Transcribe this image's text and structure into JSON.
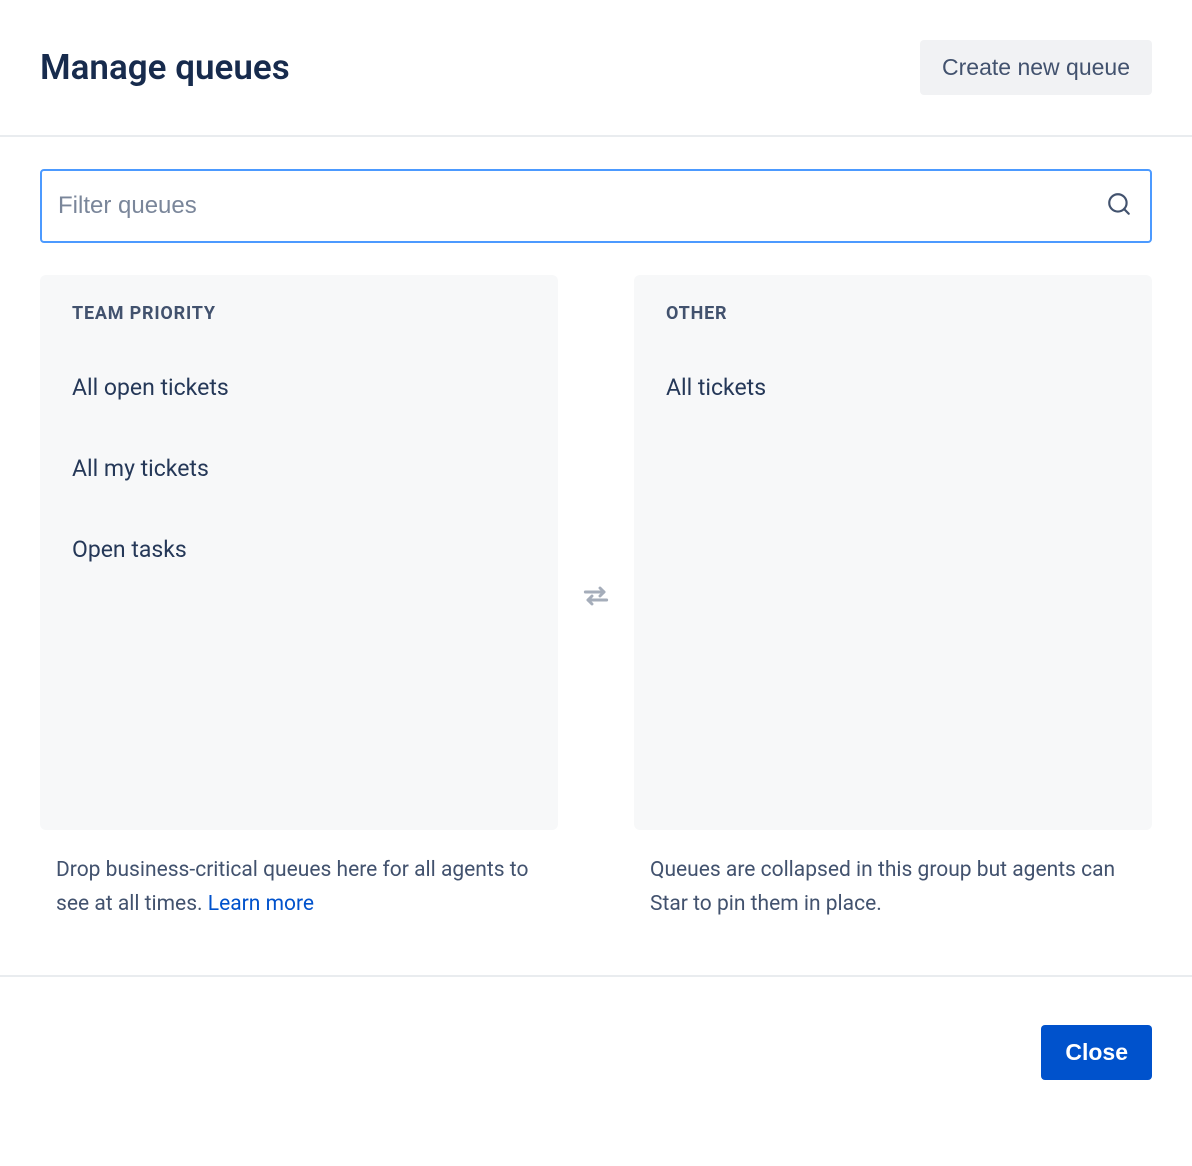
{
  "header": {
    "title": "Manage queues",
    "create_button": "Create new queue"
  },
  "search": {
    "placeholder": "Filter queues"
  },
  "columns": {
    "priority": {
      "header": "TEAM PRIORITY",
      "items": [
        "All open tickets",
        "All my tickets",
        "Open tasks"
      ],
      "helper_prefix": "Drop business-critical queues here for all agents to see at all times. ",
      "learn_more": "Learn more"
    },
    "other": {
      "header": "OTHER",
      "items": [
        "All tickets"
      ],
      "helper": "Queues are collapsed in this group but agents can Star to pin them in place."
    }
  },
  "footer": {
    "close": "Close"
  }
}
